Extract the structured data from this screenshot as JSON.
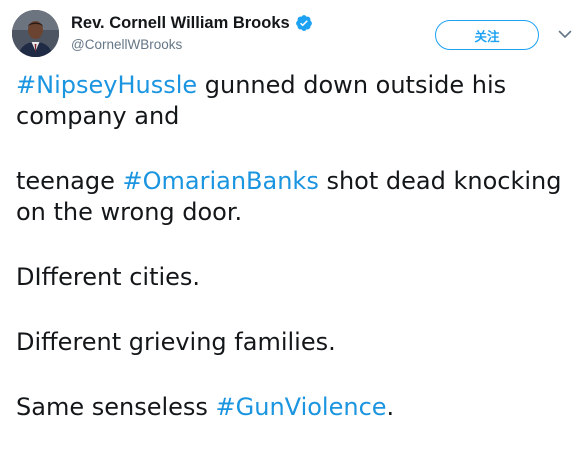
{
  "author": {
    "display_name": "Rev. Cornell William Brooks",
    "handle": "@CornellWBrooks",
    "verified": true,
    "avatar": "profile-photo"
  },
  "actions": {
    "follow_label": "关注",
    "more_icon": "chevron-down-icon"
  },
  "tweet": {
    "p1": {
      "hashtag": "#NipseyHussle",
      "text_after": " gunned down outside his company and"
    },
    "p2": {
      "text_before": "teenage ",
      "hashtag": "#OmarianBanks",
      "text_after": " shot dead knocking on the wrong door."
    },
    "p3": {
      "text": "DIfferent cities."
    },
    "p4": {
      "text": "Different grieving families."
    },
    "p5": {
      "text_before": "Same senseless ",
      "hashtag": "#GunViolence",
      "text_after": "."
    }
  },
  "colors": {
    "link": "#1b95e0",
    "verified": "#1da1f2",
    "text": "#14171a",
    "secondary": "#657786"
  }
}
